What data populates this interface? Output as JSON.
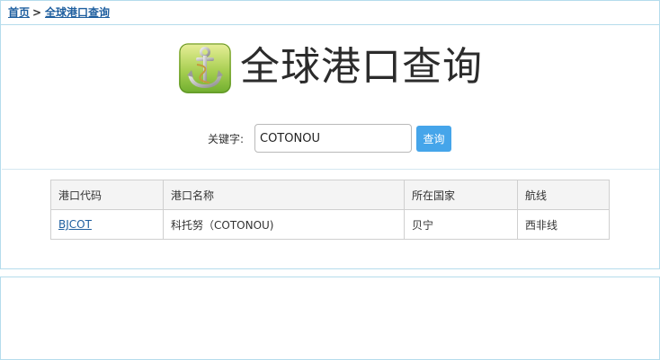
{
  "breadcrumb": {
    "home": "首页",
    "separator": ">",
    "current": "全球港口查询"
  },
  "header": {
    "logo_icon": "anchor-icon",
    "title": "全球港口查询"
  },
  "search": {
    "label": "关键字:",
    "value": "COTONOU",
    "button_label": "查询"
  },
  "table": {
    "headers": [
      "港口代码",
      "港口名称",
      "所在国家",
      "航线"
    ],
    "rows": [
      {
        "code": "BJCOT",
        "name": "科托努（COTONOU)",
        "country": "贝宁",
        "route": "西非线"
      }
    ]
  },
  "colors": {
    "accent": "#45a5ea",
    "link": "#1f5f9f",
    "border": "#b5dcec"
  }
}
